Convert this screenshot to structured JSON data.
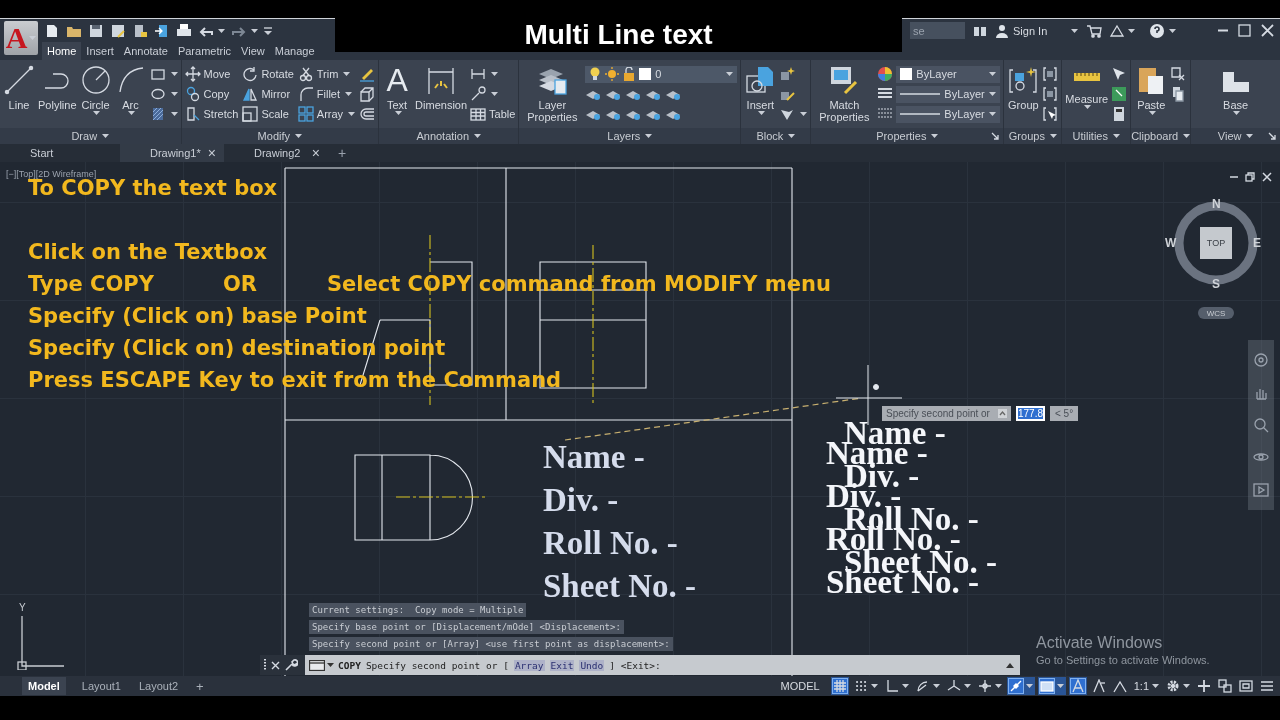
{
  "video_title": "Multi Line text",
  "app_button": {
    "glyph": "A"
  },
  "search": {
    "text": "se"
  },
  "sign_in": "Sign In",
  "ribbon_tabs": [
    {
      "label": "Home",
      "selected": true
    },
    {
      "label": "Insert",
      "selected": false
    },
    {
      "label": "Annotate",
      "selected": false
    },
    {
      "label": "Parametric",
      "selected": false
    },
    {
      "label": "View",
      "selected": false
    },
    {
      "label": "Manage",
      "selected": false
    }
  ],
  "ribbon_panels": [
    {
      "title": "Draw",
      "tools": [
        {
          "kind": "large",
          "label": "Line"
        },
        {
          "kind": "large",
          "label": "Polyline"
        },
        {
          "kind": "large",
          "label": "Circle",
          "dropdown": true
        },
        {
          "kind": "large",
          "label": "Arc",
          "dropdown": true
        },
        {
          "kind": "small",
          "dropdown": true
        },
        {
          "kind": "small",
          "dropdown": true
        },
        {
          "kind": "small",
          "dropdown": true
        }
      ]
    },
    {
      "title": "Modify",
      "tools": [
        {
          "kind": "small",
          "label": "Move"
        },
        {
          "kind": "small",
          "label": "Copy"
        },
        {
          "kind": "small",
          "label": "Stretch"
        },
        {
          "kind": "small",
          "label": "Rotate"
        },
        {
          "kind": "small",
          "label": "Mirror"
        },
        {
          "kind": "small",
          "label": "Scale"
        },
        {
          "kind": "small",
          "label": "Trim",
          "dropdown": true
        },
        {
          "kind": "small",
          "label": "Fillet",
          "dropdown": true
        },
        {
          "kind": "small",
          "label": "Array",
          "dropdown": true
        },
        {
          "kind": "small"
        },
        {
          "kind": "small"
        },
        {
          "kind": "small"
        }
      ]
    },
    {
      "title": "Annotation",
      "tools": [
        {
          "kind": "large",
          "label": "Text",
          "glyph": "A",
          "dropdown": true
        },
        {
          "kind": "large",
          "label": "Dimension"
        },
        {
          "kind": "small",
          "dropdown": true
        },
        {
          "kind": "small",
          "dropdown": true
        },
        {
          "kind": "small",
          "label": "Table"
        }
      ]
    },
    {
      "title": "Layers",
      "tools": [
        {
          "kind": "large",
          "label": "Layer Properties"
        },
        {
          "kind": "small"
        },
        {
          "kind": "small"
        },
        {
          "kind": "small"
        },
        {
          "kind": "small"
        },
        {
          "kind": "small"
        },
        {
          "kind": "small"
        },
        {
          "kind": "small"
        },
        {
          "kind": "small"
        },
        {
          "kind": "small"
        },
        {
          "kind": "small"
        }
      ],
      "combos": [
        {
          "kind": "layer",
          "value": "0"
        }
      ]
    },
    {
      "title": "Block",
      "tools": [
        {
          "kind": "large",
          "label": "Insert",
          "dropdown": true
        },
        {
          "kind": "small"
        },
        {
          "kind": "small"
        },
        {
          "kind": "small",
          "dropdown": true
        }
      ]
    },
    {
      "title": "Properties",
      "launcher": true,
      "tools": [
        {
          "kind": "large",
          "label": "Match Properties"
        }
      ],
      "combos": [
        {
          "kind": "color",
          "value": "ByLayer"
        },
        {
          "kind": "lineweight",
          "value": "ByLayer"
        },
        {
          "kind": "linetype",
          "value": "ByLayer"
        }
      ]
    },
    {
      "title": "Groups",
      "tools": [
        {
          "kind": "large",
          "label": "Group"
        },
        {
          "kind": "small"
        },
        {
          "kind": "small"
        },
        {
          "kind": "small"
        }
      ]
    },
    {
      "title": "Utilities",
      "tools": [
        {
          "kind": "large",
          "label": "Measure",
          "dropdown": true
        },
        {
          "kind": "small"
        },
        {
          "kind": "small"
        },
        {
          "kind": "small"
        }
      ]
    },
    {
      "title": "Clipboard",
      "tools": [
        {
          "kind": "large",
          "label": "Paste",
          "dropdown": true
        },
        {
          "kind": "small"
        },
        {
          "kind": "small"
        }
      ]
    },
    {
      "title": "View",
      "launcher": true,
      "tools": [
        {
          "kind": "large",
          "label": "Base",
          "dropdown": true
        }
      ]
    }
  ],
  "file_tabs": [
    {
      "label": "Start",
      "selected": false
    },
    {
      "label": "Drawing1*",
      "selected": true,
      "close": "×"
    },
    {
      "label": "Drawing2",
      "selected": false,
      "close": "×"
    }
  ],
  "new_tab": "+",
  "viewport_label": "[−][Top][2D Wireframe]",
  "instructions": [
    {
      "parts": [
        "To COPY the text box"
      ]
    },
    {
      "parts": [
        "Click on the Textbox"
      ]
    },
    {
      "parts": [
        "Type COPY",
        "OR",
        "Select COPY command from MODIFY menu"
      ]
    },
    {
      "parts": [
        "Specify (Click on) base Point"
      ]
    },
    {
      "parts": [
        "Specify (Click on) destination point"
      ]
    },
    {
      "parts": [
        "Press ESCAPE Key to exit from the Command"
      ]
    }
  ],
  "text_blocks": [
    {
      "lines": [
        "Name -",
        "Div. -",
        "Roll No. -",
        "Sheet No. -"
      ]
    },
    {
      "lines": [
        "Name -",
        "Div. -",
        "Roll No. -",
        "Sheet No. -"
      ]
    },
    {
      "lines": [
        "Name -",
        "Div. -",
        "Roll No. -",
        "Sheet No. -"
      ]
    }
  ],
  "viewcube": {
    "north": "N",
    "south": "S",
    "east": "E",
    "west": "W",
    "face": "TOP",
    "ucs": "WCS"
  },
  "dynamic_input": {
    "prompt": "Specify second point or",
    "distance": "177.8",
    "angle": "< 5°"
  },
  "command_history": [
    "Current settings:  Copy mode = Multiple",
    "Specify base point or [Displacement/mOde] <Displacement>:",
    "Specify second point or [Array] <use first point as displacement>:"
  ],
  "command_line": {
    "parts": [
      {
        "kind": "command",
        "text": "COPY"
      },
      {
        "kind": "text",
        "text": "Specify second point or ["
      },
      {
        "kind": "option",
        "text": "Array"
      },
      {
        "kind": "option",
        "text": "Exit"
      },
      {
        "kind": "option",
        "text": "Undo"
      },
      {
        "kind": "text",
        "text": "] <Exit>:"
      }
    ]
  },
  "ucs": {
    "y_label": "Y"
  },
  "activation": {
    "title": "Activate Windows",
    "hint": "Go to Settings to activate Windows."
  },
  "layout_tabs": [
    {
      "label": "Model",
      "selected": true
    },
    {
      "label": "Layout1",
      "selected": false
    },
    {
      "label": "Layout2",
      "selected": false
    }
  ],
  "new_layout": "+",
  "status": {
    "space": "MODEL",
    "scale": "1:1",
    "toggles": [
      {
        "on": true
      },
      {
        "on": false
      },
      {
        "on": false
      },
      {
        "on": false
      },
      {
        "on": false
      },
      {
        "on": false
      },
      {
        "on": true
      },
      {
        "on": true
      },
      {
        "on": true
      },
      {
        "on": false
      },
      {
        "on": false
      }
    ]
  }
}
